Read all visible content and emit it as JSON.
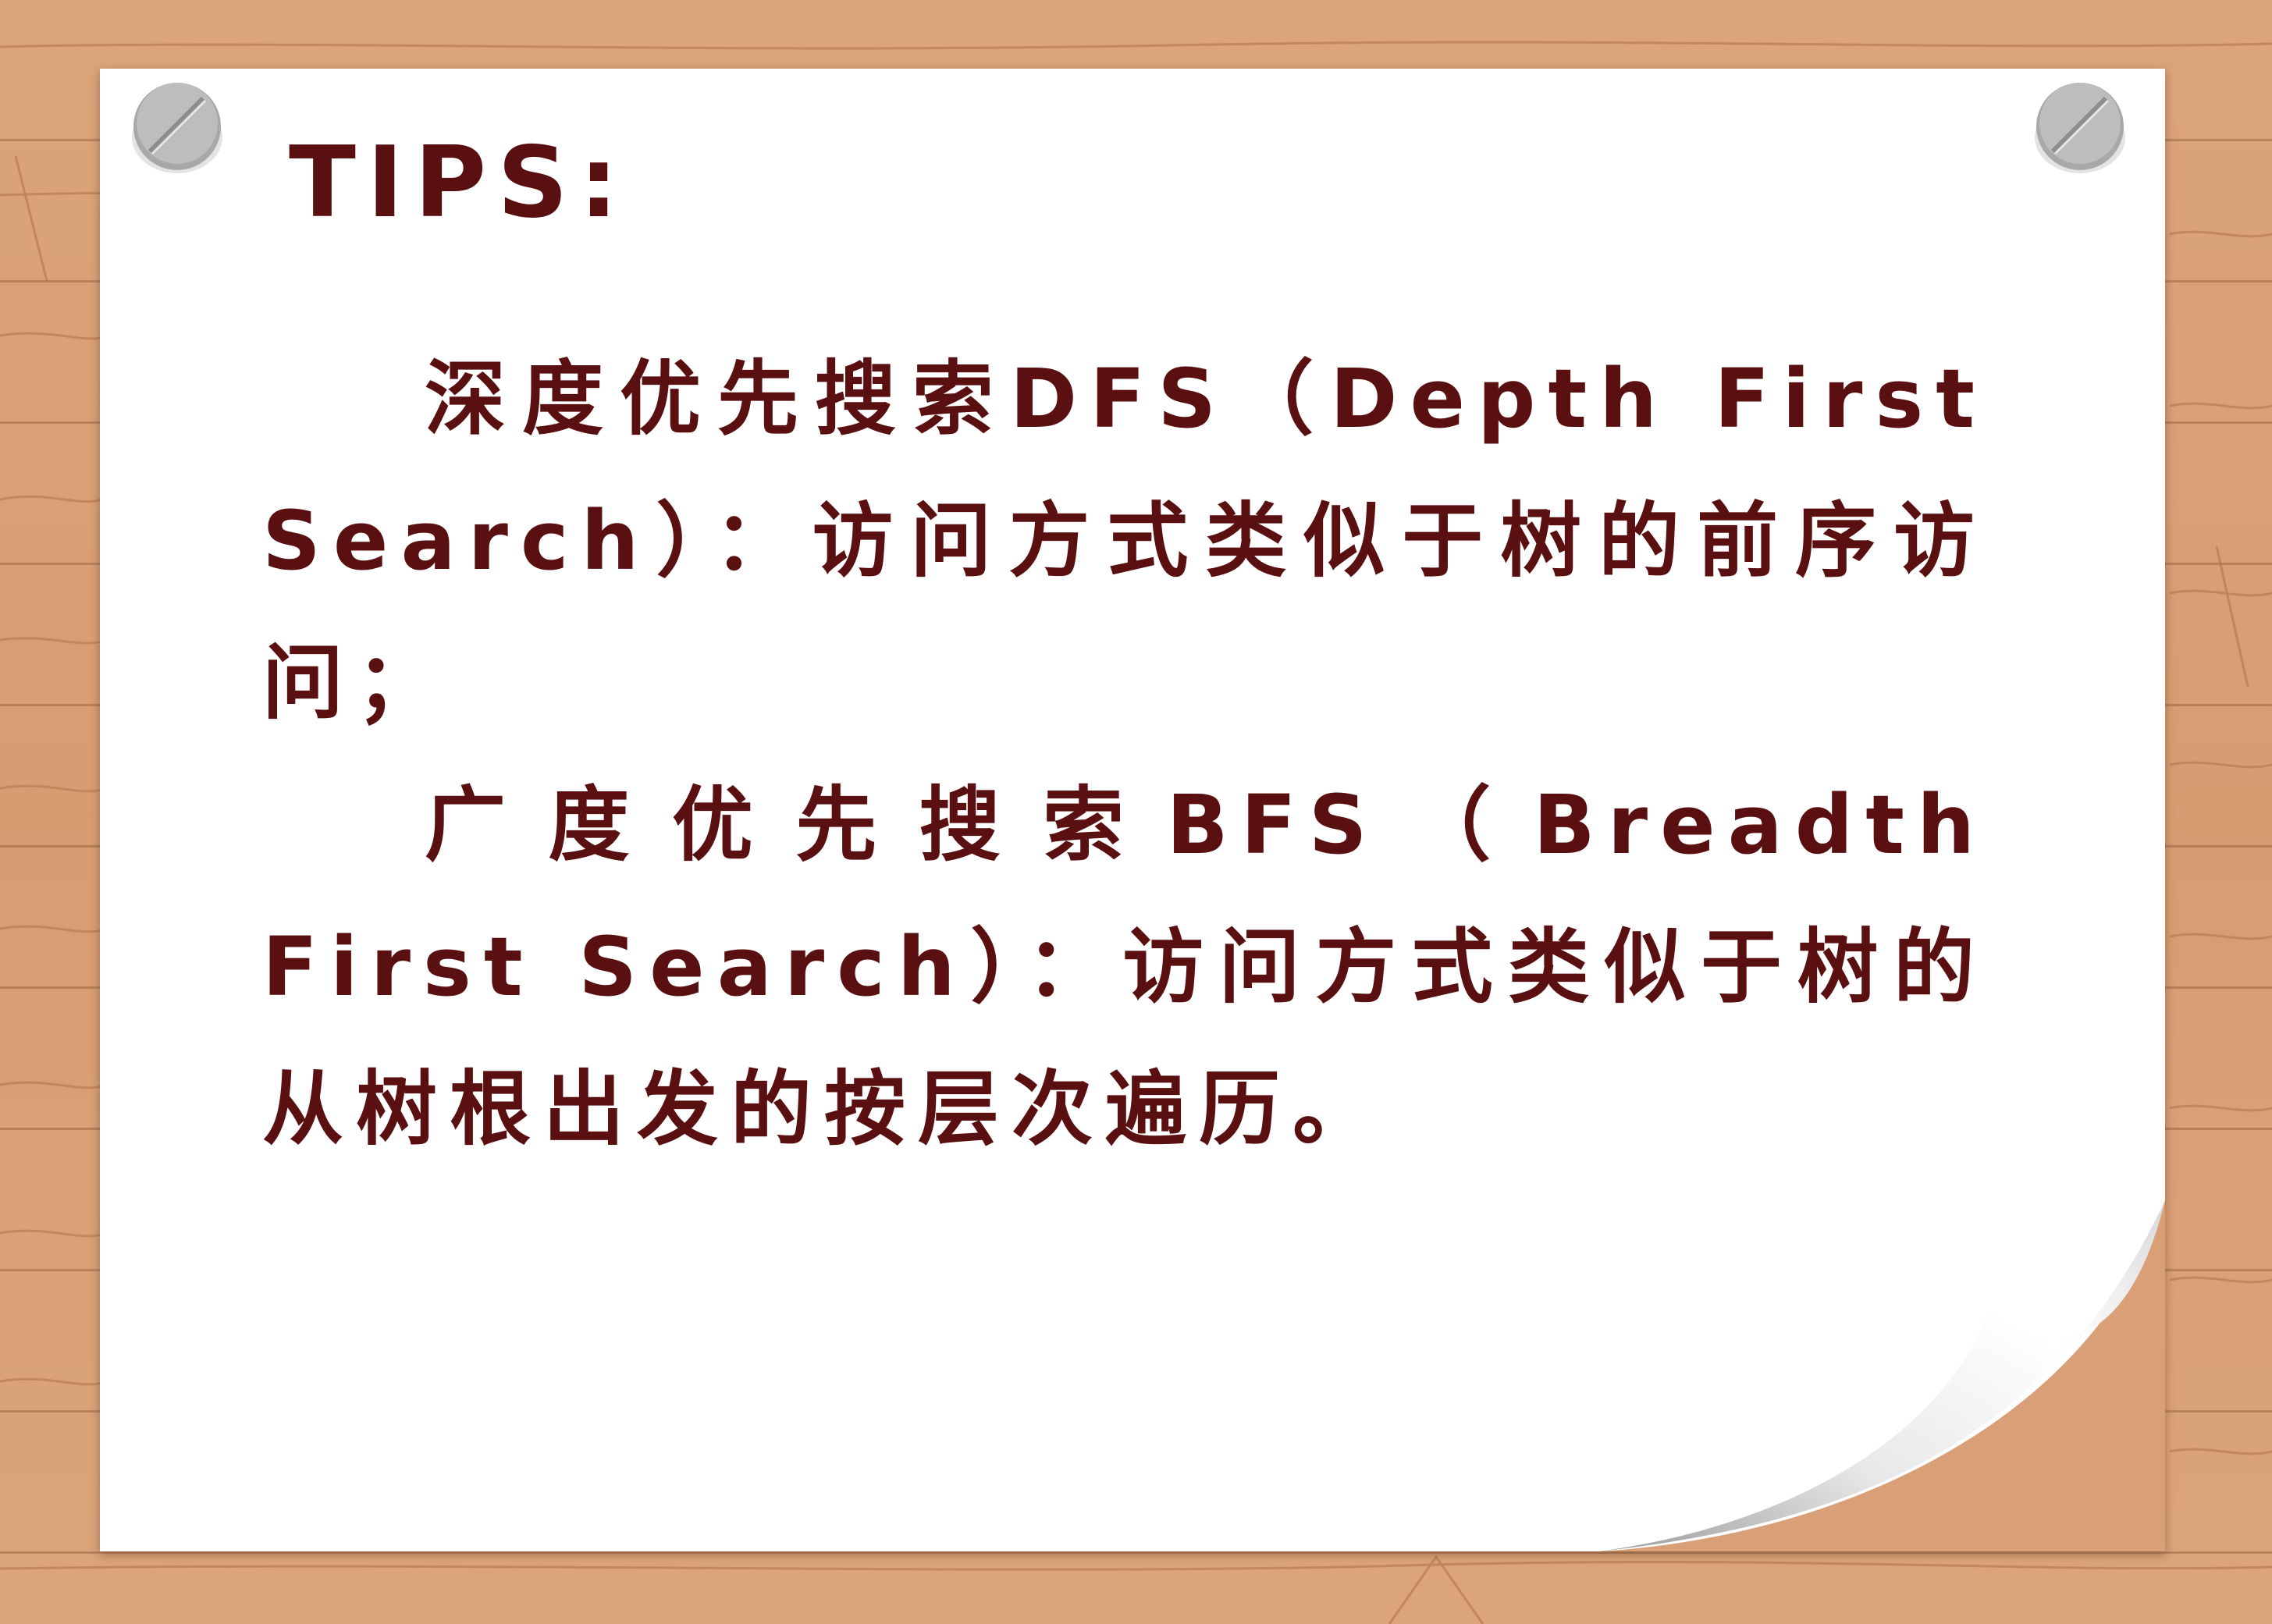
{
  "title": "TIPS:",
  "tips": [
    {
      "text": "深度优先搜索DFS（Depth First Search）：访问方式类似于树的前序访问；"
    },
    {
      "text": "广度优先搜索BFS（Breadth First Search）：访问方式类似于树的从树根出发的按层次遍历。"
    }
  ],
  "colors": {
    "text": "#5a0f10",
    "paper": "#ffffff",
    "wood": "#d9a077",
    "pin": "#b5b5b5"
  },
  "icons": {
    "left_pin": "pushpin-icon",
    "right_pin": "pushpin-icon"
  }
}
